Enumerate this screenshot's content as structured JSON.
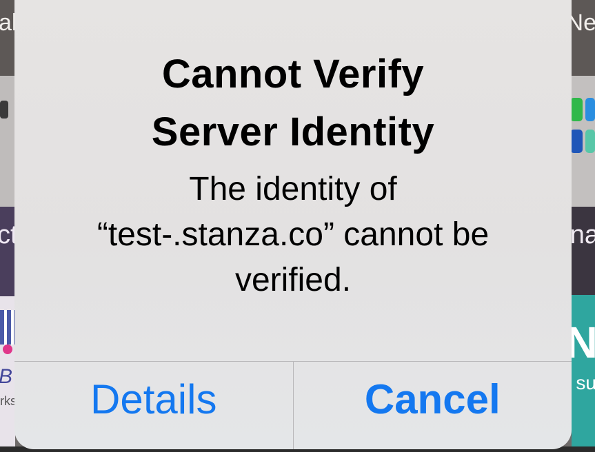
{
  "background": {
    "left_top_text": "al",
    "left_mid_text": "ct",
    "left_bottom_text_1": "B",
    "left_bottom_text_2": "rks",
    "right_top_text": "Ne",
    "right_mid_text": "na",
    "right_bottom_text_1": "N",
    "right_bottom_text_2": "su"
  },
  "alert": {
    "title_line_1": "Cannot Verify",
    "title_line_2": "Server Identity",
    "message_line_1": "The identity of",
    "message_line_2": "“test-.stanza.co” cannot be",
    "message_line_3": "verified.",
    "details_label": "Details",
    "cancel_label": "Cancel"
  },
  "colors": {
    "accent": "#1478f0",
    "alert_background": "#e4e2e2",
    "separator": "#b9b8ba"
  }
}
